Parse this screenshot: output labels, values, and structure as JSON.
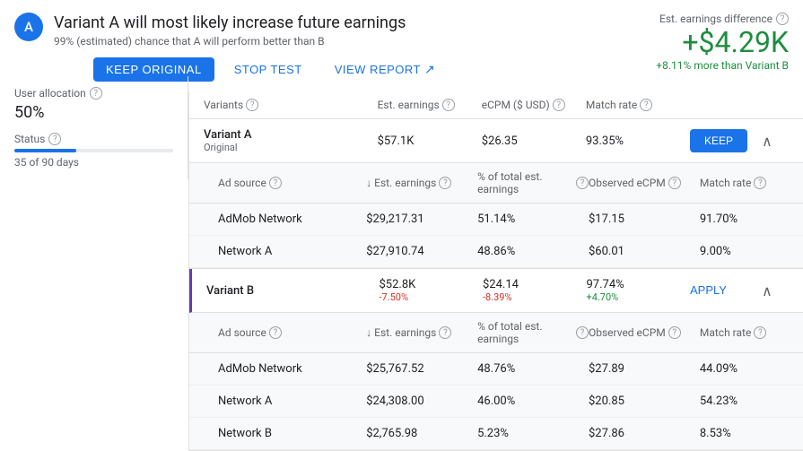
{
  "avatar": {
    "letter": "A"
  },
  "header": {
    "title": "Variant A will most likely increase future earnings",
    "subtitle": "99% (estimated) chance that A will perform better than B",
    "buttons": {
      "keep": "KEEP ORIGINAL",
      "stop": "STOP TEST",
      "view": "VIEW REPORT"
    }
  },
  "earnings": {
    "label": "Est. earnings difference",
    "value": "+$4.29K",
    "subtext": "+8.11% more than Variant B"
  },
  "left_panel": {
    "allocation_label": "User allocation",
    "allocation_value": "50%",
    "status_label": "Status",
    "days_label": "35 of 90 days",
    "progress_pct": 39
  },
  "table": {
    "columns": [
      "Variants",
      "Est. earnings",
      "eCPM ($ USD)",
      "Match rate",
      "",
      ""
    ],
    "variants": [
      {
        "name": "Variant A",
        "badge": "Original",
        "est_earnings": "$57.1K",
        "ecpm": "$26.35",
        "match_rate": "93.35%",
        "action": "KEEP",
        "is_b": false,
        "sub_rows": [
          {
            "source": "AdMob Network",
            "est_earnings": "$29,217.31",
            "pct_earnings": "51.14%",
            "observed_ecpm": "$17.15",
            "match_rate": "91.70%"
          },
          {
            "source": "Network A",
            "est_earnings": "$27,910.74",
            "pct_earnings": "48.86%",
            "observed_ecpm": "$60.01",
            "match_rate": "9.00%"
          }
        ]
      },
      {
        "name": "Variant B",
        "badge": "",
        "est_earnings": "$52.8K",
        "est_earnings_delta": "-7.50%",
        "ecpm": "$24.14",
        "ecpm_delta": "-8.39%",
        "match_rate": "97.74%",
        "match_rate_delta": "+4.70%",
        "action": "APPLY",
        "is_b": true,
        "sub_rows": [
          {
            "source": "AdMob Network",
            "est_earnings": "$25,767.52",
            "pct_earnings": "48.76%",
            "observed_ecpm": "$27.89",
            "match_rate": "44.09%"
          },
          {
            "source": "Network A",
            "est_earnings": "$24,308.00",
            "pct_earnings": "46.00%",
            "observed_ecpm": "$20.85",
            "match_rate": "54.23%"
          },
          {
            "source": "Network B",
            "est_earnings": "$2,765.98",
            "pct_earnings": "5.23%",
            "observed_ecpm": "$27.86",
            "match_rate": "8.53%"
          }
        ]
      }
    ],
    "sub_columns": [
      "Ad source",
      "↓ Est. earnings",
      "% of total est. earnings",
      "Observed eCPM",
      "Match rate"
    ]
  }
}
